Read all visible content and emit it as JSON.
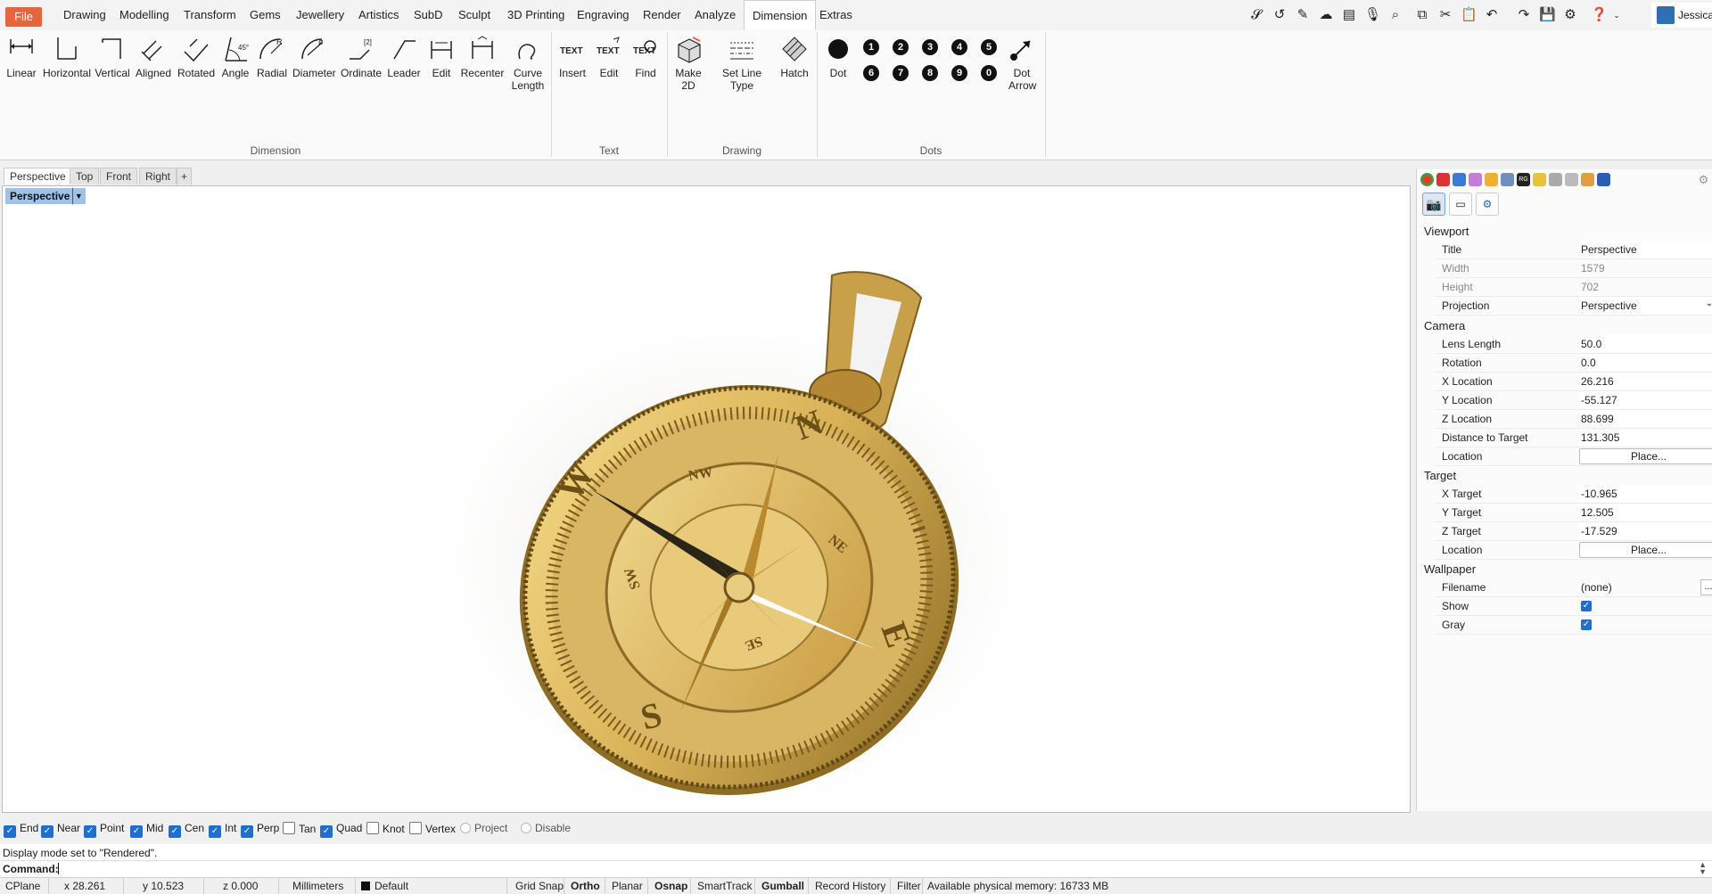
{
  "menu_tabs": [
    "File",
    "Drawing",
    "Modelling",
    "Transform",
    "Gems",
    "Jewellery",
    "Artistics",
    "SubD",
    "Sculpt",
    "3D Printing",
    "Engraving",
    "Render",
    "Analyze",
    "Dimension",
    "Extras"
  ],
  "active_tab": "Dimension",
  "user": {
    "name": "Jessica"
  },
  "ribbon": {
    "dimension": {
      "label": "Dimension",
      "buttons": [
        "Linear",
        "Horizontal",
        "Vertical",
        "Aligned",
        "Rotated",
        "Angle",
        "Radial",
        "Diameter",
        "Ordinate",
        "Leader",
        "Edit",
        "Recenter",
        "Curve Length"
      ]
    },
    "text": {
      "label": "Text",
      "buttons": [
        "Insert",
        "Edit",
        "Find"
      ]
    },
    "drawing": {
      "label": "Drawing",
      "buttons": [
        "Make 2D",
        "Set Line Type",
        "Hatch"
      ]
    },
    "dots": {
      "label": "Dots",
      "buttons": [
        "Dot",
        "Dot Arrow"
      ],
      "numbers": [
        "1",
        "2",
        "3",
        "4",
        "5",
        "6",
        "7",
        "8",
        "9",
        "0"
      ]
    }
  },
  "viewport_tabs": [
    "Perspective",
    "Top",
    "Front",
    "Right"
  ],
  "viewport": {
    "title": "Perspective",
    "compass_letters": [
      "N",
      "E",
      "S",
      "W",
      "NE",
      "SE",
      "SW",
      "NW"
    ]
  },
  "panel": {
    "viewport": {
      "header": "Viewport",
      "title_k": "Title",
      "title_v": "Perspective",
      "width_k": "Width",
      "width_v": "1579",
      "height_k": "Height",
      "height_v": "702",
      "proj_k": "Projection",
      "proj_v": "Perspective"
    },
    "camera": {
      "header": "Camera",
      "lens_k": "Lens Length",
      "lens_v": "50.0",
      "rot_k": "Rotation",
      "rot_v": "0.0",
      "x_k": "X Location",
      "x_v": "26.216",
      "y_k": "Y Location",
      "y_v": "-55.127",
      "z_k": "Z Location",
      "z_v": "88.699",
      "dist_k": "Distance to Target",
      "dist_v": "131.305",
      "loc_k": "Location",
      "loc_btn": "Place..."
    },
    "target": {
      "header": "Target",
      "x_k": "X Target",
      "x_v": "-10.965",
      "y_k": "Y Target",
      "y_v": "12.505",
      "z_k": "Z Target",
      "z_v": "-17.529",
      "loc_k": "Location",
      "loc_btn": "Place..."
    },
    "wallpaper": {
      "header": "Wallpaper",
      "file_k": "Filename",
      "file_v": "(none)",
      "file_btn": "...",
      "show_k": "Show",
      "show_v": true,
      "gray_k": "Gray",
      "gray_v": true
    }
  },
  "osnaps": [
    {
      "label": "End",
      "on": true
    },
    {
      "label": "Near",
      "on": true
    },
    {
      "label": "Point",
      "on": true
    },
    {
      "label": "Mid",
      "on": true
    },
    {
      "label": "Cen",
      "on": true
    },
    {
      "label": "Int",
      "on": true
    },
    {
      "label": "Perp",
      "on": true
    },
    {
      "label": "Tan",
      "on": false
    },
    {
      "label": "Quad",
      "on": true
    },
    {
      "label": "Knot",
      "on": false
    },
    {
      "label": "Vertex",
      "on": false
    },
    {
      "label": "Project",
      "on": false
    },
    {
      "label": "Disable",
      "on": false
    }
  ],
  "command": {
    "history": "Display mode set to \"Rendered\".",
    "prompt": "Command:"
  },
  "status": {
    "cplane": "CPlane",
    "x": "x 28.261",
    "y": "y 10.523",
    "z": "z 0.000",
    "units": "Millimeters",
    "layer": "Default",
    "grid_snap": "Grid Snap",
    "ortho": "Ortho",
    "planar": "Planar",
    "osnap": "Osnap",
    "smarttrack": "SmartTrack",
    "gumball": "Gumball",
    "record_history": "Record History",
    "filter": "Filter",
    "memory": "Available physical memory: 16733 MB"
  }
}
